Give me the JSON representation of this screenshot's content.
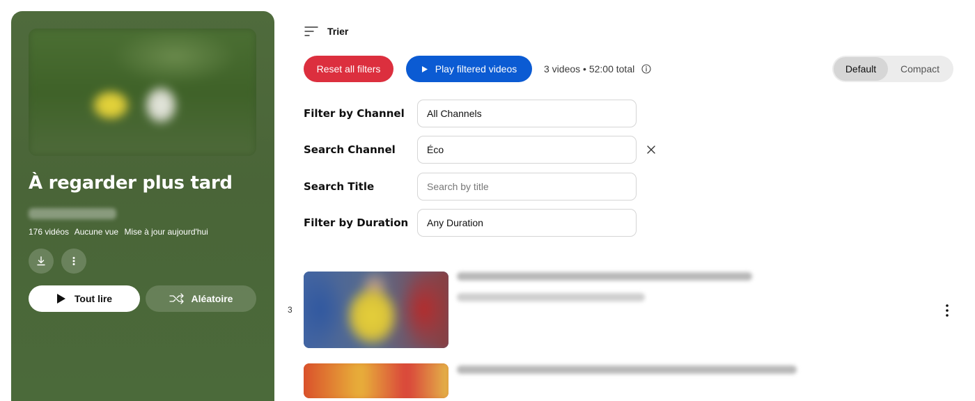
{
  "playlist": {
    "title": "À regarder plus tard",
    "meta": [
      "176 vidéos",
      "Aucune vue",
      "Mise à jour aujourd'hui"
    ],
    "play_all_label": "Tout lire",
    "shuffle_label": "Aléatoire",
    "background_color": "#4b6a3a"
  },
  "toolbar": {
    "sort_label": "Trier",
    "reset_label": "Reset all filters",
    "play_filtered_label": "Play filtered videos",
    "summary": "3 videos • 52:00 total",
    "view_modes": [
      "Default",
      "Compact"
    ],
    "active_view": "Default",
    "reset_color": "#dc2f3e",
    "play_color": "#0b5bd3"
  },
  "filters": {
    "channel": {
      "label": "Filter by Channel",
      "value": "All Channels"
    },
    "search_channel": {
      "label": "Search Channel",
      "value": "Éco"
    },
    "search_title": {
      "label": "Search Title",
      "value": "",
      "placeholder": "Search by title"
    },
    "duration": {
      "label": "Filter by Duration",
      "value": "Any Duration"
    }
  },
  "videos": {
    "first_index": "3"
  },
  "icons": {
    "sort": "sort-icon",
    "play": "play-icon",
    "info": "info-icon",
    "clear": "close-icon",
    "download": "download-icon",
    "more": "more-vert-icon",
    "shuffle": "shuffle-icon"
  }
}
